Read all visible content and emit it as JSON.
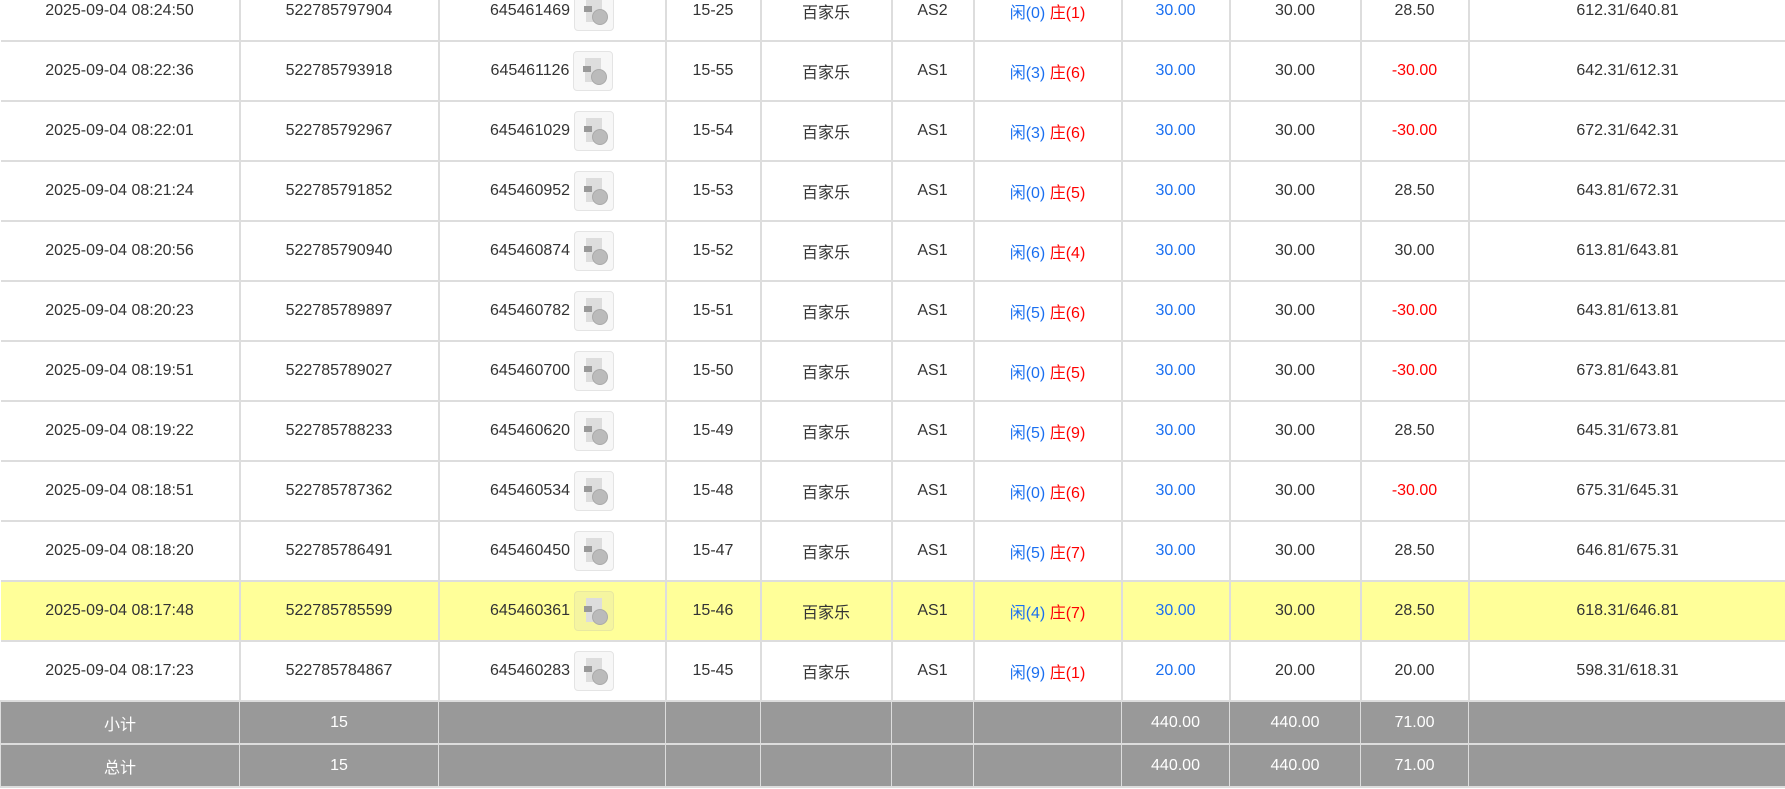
{
  "rows": [
    {
      "time": "2025-09-04 08:24:50",
      "order": "522785797904",
      "round": "645461469",
      "shoe": "15-25",
      "game": "百家乐",
      "table": "AS2",
      "player": "闲(0)",
      "banker": "庄(1)",
      "bet": "30.00",
      "valid": "30.00",
      "win": "28.50",
      "win_neg": false,
      "balance": "612.31/640.81",
      "highlight": false
    },
    {
      "time": "2025-09-04 08:22:36",
      "order": "522785793918",
      "round": "645461126",
      "shoe": "15-55",
      "game": "百家乐",
      "table": "AS1",
      "player": "闲(3)",
      "banker": "庄(6)",
      "bet": "30.00",
      "valid": "30.00",
      "win": "-30.00",
      "win_neg": true,
      "balance": "642.31/612.31",
      "highlight": false
    },
    {
      "time": "2025-09-04 08:22:01",
      "order": "522785792967",
      "round": "645461029",
      "shoe": "15-54",
      "game": "百家乐",
      "table": "AS1",
      "player": "闲(3)",
      "banker": "庄(6)",
      "bet": "30.00",
      "valid": "30.00",
      "win": "-30.00",
      "win_neg": true,
      "balance": "672.31/642.31",
      "highlight": false
    },
    {
      "time": "2025-09-04 08:21:24",
      "order": "522785791852",
      "round": "645460952",
      "shoe": "15-53",
      "game": "百家乐",
      "table": "AS1",
      "player": "闲(0)",
      "banker": "庄(5)",
      "bet": "30.00",
      "valid": "30.00",
      "win": "28.50",
      "win_neg": false,
      "balance": "643.81/672.31",
      "highlight": false
    },
    {
      "time": "2025-09-04 08:20:56",
      "order": "522785790940",
      "round": "645460874",
      "shoe": "15-52",
      "game": "百家乐",
      "table": "AS1",
      "player": "闲(6)",
      "banker": "庄(4)",
      "bet": "30.00",
      "valid": "30.00",
      "win": "30.00",
      "win_neg": false,
      "balance": "613.81/643.81",
      "highlight": false
    },
    {
      "time": "2025-09-04 08:20:23",
      "order": "522785789897",
      "round": "645460782",
      "shoe": "15-51",
      "game": "百家乐",
      "table": "AS1",
      "player": "闲(5)",
      "banker": "庄(6)",
      "bet": "30.00",
      "valid": "30.00",
      "win": "-30.00",
      "win_neg": true,
      "balance": "643.81/613.81",
      "highlight": false
    },
    {
      "time": "2025-09-04 08:19:51",
      "order": "522785789027",
      "round": "645460700",
      "shoe": "15-50",
      "game": "百家乐",
      "table": "AS1",
      "player": "闲(0)",
      "banker": "庄(5)",
      "bet": "30.00",
      "valid": "30.00",
      "win": "-30.00",
      "win_neg": true,
      "balance": "673.81/643.81",
      "highlight": false
    },
    {
      "time": "2025-09-04 08:19:22",
      "order": "522785788233",
      "round": "645460620",
      "shoe": "15-49",
      "game": "百家乐",
      "table": "AS1",
      "player": "闲(5)",
      "banker": "庄(9)",
      "bet": "30.00",
      "valid": "30.00",
      "win": "28.50",
      "win_neg": false,
      "balance": "645.31/673.81",
      "highlight": false
    },
    {
      "time": "2025-09-04 08:18:51",
      "order": "522785787362",
      "round": "645460534",
      "shoe": "15-48",
      "game": "百家乐",
      "table": "AS1",
      "player": "闲(0)",
      "banker": "庄(6)",
      "bet": "30.00",
      "valid": "30.00",
      "win": "-30.00",
      "win_neg": true,
      "balance": "675.31/645.31",
      "highlight": false
    },
    {
      "time": "2025-09-04 08:18:20",
      "order": "522785786491",
      "round": "645460450",
      "shoe": "15-47",
      "game": "百家乐",
      "table": "AS1",
      "player": "闲(5)",
      "banker": "庄(7)",
      "bet": "30.00",
      "valid": "30.00",
      "win": "28.50",
      "win_neg": false,
      "balance": "646.81/675.31",
      "highlight": false
    },
    {
      "time": "2025-09-04 08:17:48",
      "order": "522785785599",
      "round": "645460361",
      "shoe": "15-46",
      "game": "百家乐",
      "table": "AS1",
      "player": "闲(4)",
      "banker": "庄(7)",
      "bet": "30.00",
      "valid": "30.00",
      "win": "28.50",
      "win_neg": false,
      "balance": "618.31/646.81",
      "highlight": true
    },
    {
      "time": "2025-09-04 08:17:23",
      "order": "522785784867",
      "round": "645460283",
      "shoe": "15-45",
      "game": "百家乐",
      "table": "AS1",
      "player": "闲(9)",
      "banker": "庄(1)",
      "bet": "20.00",
      "valid": "20.00",
      "win": "20.00",
      "win_neg": false,
      "balance": "598.31/618.31",
      "highlight": false
    }
  ],
  "subtotal": {
    "label": "小计",
    "count": "15",
    "bet": "440.00",
    "valid": "440.00",
    "win": "71.00"
  },
  "total": {
    "label": "总计",
    "count": "15",
    "bet": "440.00",
    "valid": "440.00",
    "win": "71.00"
  },
  "icons": {
    "replay": "video-replay-icon"
  },
  "colors": {
    "player": "#1a6ff0",
    "banker": "#ff0000",
    "negative": "#ff0000",
    "highlight": "#ffff99",
    "summary_bg": "#999999"
  }
}
